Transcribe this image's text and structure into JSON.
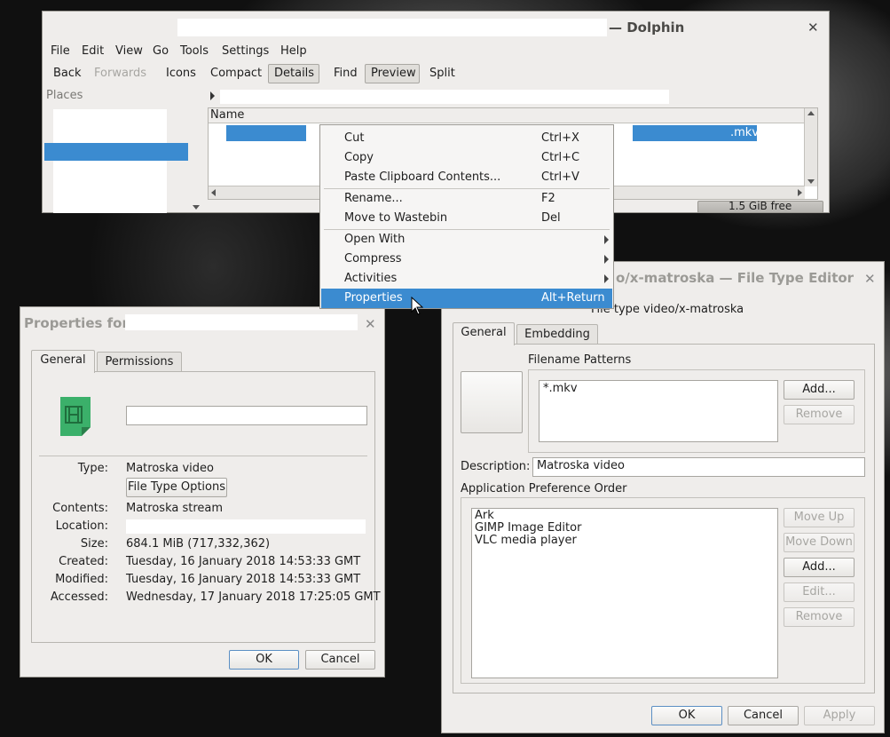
{
  "dolphin": {
    "title": "— Dolphin",
    "menu": [
      "File",
      "Edit",
      "View",
      "Go",
      "Tools",
      "Settings",
      "Help"
    ],
    "toolbar": {
      "back": "Back",
      "forward": "Forwards",
      "icons": "Icons",
      "compact": "Compact",
      "details": "Details",
      "find": "Find",
      "preview": "Preview",
      "split": "Split"
    },
    "places_label": "Places",
    "column_name": "Name",
    "selected_file_suffix": ".mkv",
    "free_space": "1.5 GiB free"
  },
  "context_menu": {
    "items": [
      {
        "label": "Cut",
        "shortcut": "Ctrl+X"
      },
      {
        "label": "Copy",
        "shortcut": "Ctrl+C"
      },
      {
        "label": "Paste Clipboard Contents...",
        "shortcut": "Ctrl+V"
      },
      {
        "label": "Rename...",
        "shortcut": "F2"
      },
      {
        "label": "Move to Wastebin",
        "shortcut": "Del"
      },
      {
        "label": "Open With",
        "shortcut": ""
      },
      {
        "label": "Compress",
        "shortcut": ""
      },
      {
        "label": "Activities",
        "shortcut": ""
      },
      {
        "label": "Properties",
        "shortcut": "Alt+Return"
      }
    ]
  },
  "properties": {
    "title": "Properties for",
    "tabs": [
      "General",
      "Permissions"
    ],
    "type_label": "Type:",
    "type_value": "Matroska video",
    "file_type_options": "File Type Options",
    "contents_label": "Contents:",
    "contents_value": "Matroska stream",
    "location_label": "Location:",
    "size_label": "Size:",
    "size_value": "684.1 MiB (717,332,362)",
    "created_label": "Created:",
    "created_value": "Tuesday, 16 January 2018 14:53:33 GMT",
    "modified_label": "Modified:",
    "modified_value": "Tuesday, 16 January 2018 14:53:33 GMT",
    "accessed_label": "Accessed:",
    "accessed_value": "Wednesday, 17 January 2018 17:25:05 GMT",
    "ok": "OK",
    "cancel": "Cancel"
  },
  "file_type_editor": {
    "title": "o/x-matroska — File Type Editor",
    "header": "File type video/x-matroska",
    "tabs": [
      "General",
      "Embedding"
    ],
    "filename_patterns_label": "Filename Patterns",
    "patterns": [
      "*.mkv"
    ],
    "add": "Add...",
    "remove": "Remove",
    "description_label": "Description:",
    "description_value": "Matroska video",
    "app_pref_label": "Application Preference Order",
    "apps": [
      "Ark",
      "GIMP Image Editor",
      "VLC media player"
    ],
    "move_up": "Move Up",
    "move_down": "Move Down",
    "add2": "Add...",
    "edit": "Edit...",
    "remove2": "Remove",
    "ok": "OK",
    "cancel": "Cancel",
    "apply": "Apply"
  },
  "colors": {
    "selection": "#3b8bd0",
    "window_bg": "#efedeb",
    "icon_green": "#3bb06a"
  }
}
